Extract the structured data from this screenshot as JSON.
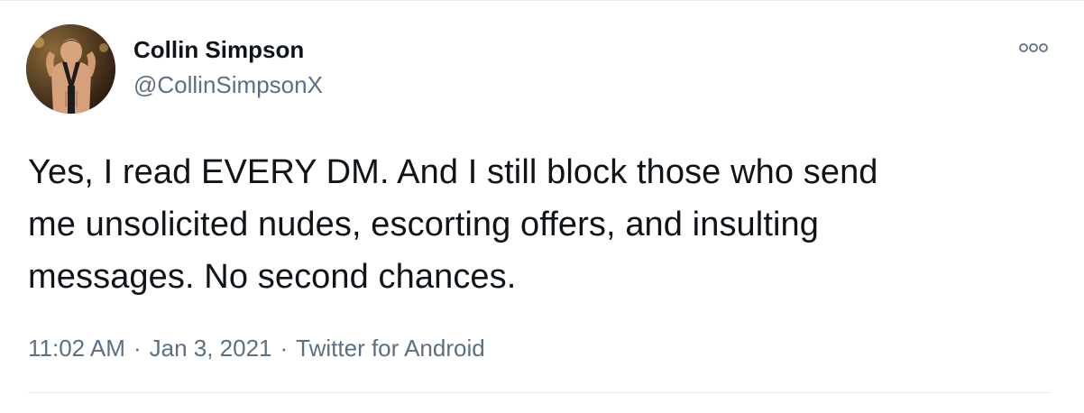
{
  "author": {
    "display_name": "Collin Simpson",
    "handle": "@CollinSimpsonX"
  },
  "tweet": {
    "lines": [
      "Yes, I read EVERY DM. And I still block those who send",
      "me unsolicited nudes, escorting offers, and insulting",
      "messages. No second chances."
    ],
    "time": "11:02 AM",
    "date": "Jan 3, 2021",
    "source": "Twitter for Android",
    "separator": "·"
  },
  "icons": {
    "more": "more-options-icon"
  },
  "colors": {
    "text": "#0f1419",
    "secondary": "#5b7083",
    "divider": "#e7ecef"
  }
}
